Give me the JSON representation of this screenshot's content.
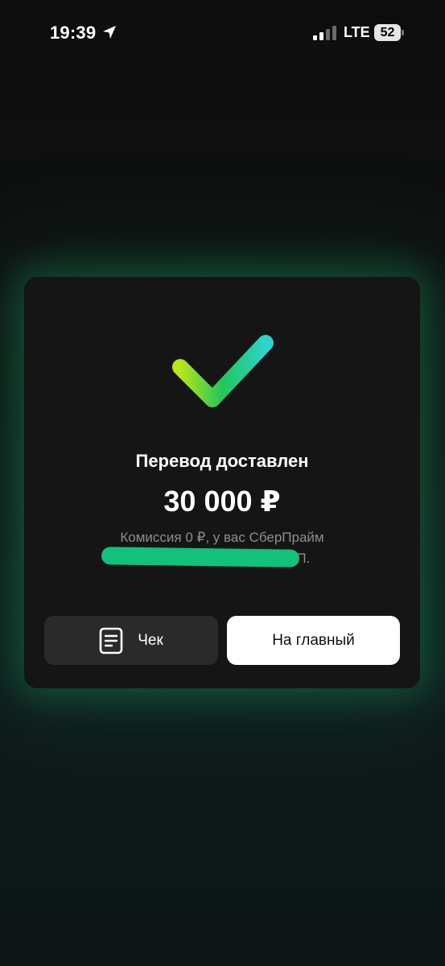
{
  "status_bar": {
    "time": "19:39",
    "network": "LTE",
    "battery": "52",
    "icons": [
      "location-arrow-icon",
      "signal-icon",
      "battery-icon"
    ]
  },
  "card": {
    "icon": "checkmark-icon",
    "title": "Перевод доставлен",
    "amount": "30 000 ₽",
    "commission": "Комиссия 0 ₽, у вас СберПрайм",
    "recipient_visible": "ч П.",
    "buttons": {
      "receipt_label": "Чек",
      "home_label": "На главный"
    }
  },
  "colors": {
    "card_background": "#151515",
    "glow": "#18965a",
    "redaction": "#11c17c",
    "check_gradient": [
      "#b7e61b",
      "#21c65a",
      "#2fd3cf"
    ]
  }
}
